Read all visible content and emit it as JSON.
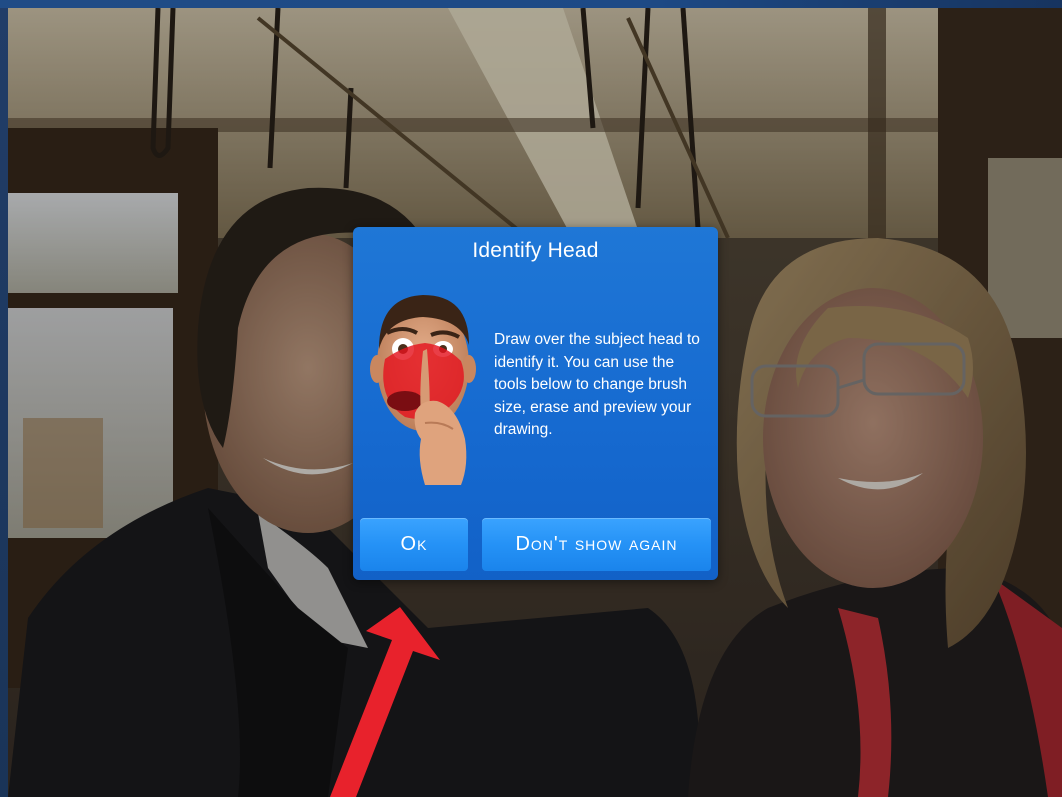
{
  "dialog": {
    "title": "Identify Head",
    "body": "Draw over the subject head to identify it. You can use the tools below to change brush size, erase and preview your drawing.",
    "ok_label": "Ok",
    "dont_show_label": "Don't show again"
  },
  "colors": {
    "dialog_background": "#166ad0",
    "button_background": "#2592f6",
    "annotation_arrow": "#e8222c"
  },
  "icons": {
    "illustration": "head-highlight-illustration",
    "annotation": "red-arrow-icon"
  }
}
